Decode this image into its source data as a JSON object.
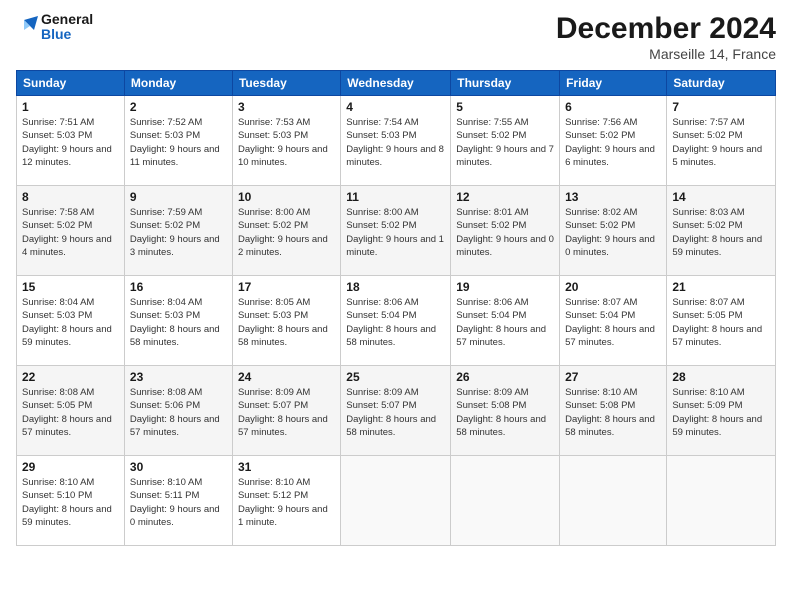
{
  "header": {
    "logo_line1": "General",
    "logo_line2": "Blue",
    "title": "December 2024",
    "location": "Marseille 14, France"
  },
  "weekdays": [
    "Sunday",
    "Monday",
    "Tuesday",
    "Wednesday",
    "Thursday",
    "Friday",
    "Saturday"
  ],
  "weeks": [
    [
      {
        "day": "1",
        "sunrise": "7:51 AM",
        "sunset": "5:03 PM",
        "daylight": "9 hours and 12 minutes."
      },
      {
        "day": "2",
        "sunrise": "7:52 AM",
        "sunset": "5:03 PM",
        "daylight": "9 hours and 11 minutes."
      },
      {
        "day": "3",
        "sunrise": "7:53 AM",
        "sunset": "5:03 PM",
        "daylight": "9 hours and 10 minutes."
      },
      {
        "day": "4",
        "sunrise": "7:54 AM",
        "sunset": "5:03 PM",
        "daylight": "9 hours and 8 minutes."
      },
      {
        "day": "5",
        "sunrise": "7:55 AM",
        "sunset": "5:02 PM",
        "daylight": "9 hours and 7 minutes."
      },
      {
        "day": "6",
        "sunrise": "7:56 AM",
        "sunset": "5:02 PM",
        "daylight": "9 hours and 6 minutes."
      },
      {
        "day": "7",
        "sunrise": "7:57 AM",
        "sunset": "5:02 PM",
        "daylight": "9 hours and 5 minutes."
      }
    ],
    [
      {
        "day": "8",
        "sunrise": "7:58 AM",
        "sunset": "5:02 PM",
        "daylight": "9 hours and 4 minutes."
      },
      {
        "day": "9",
        "sunrise": "7:59 AM",
        "sunset": "5:02 PM",
        "daylight": "9 hours and 3 minutes."
      },
      {
        "day": "10",
        "sunrise": "8:00 AM",
        "sunset": "5:02 PM",
        "daylight": "9 hours and 2 minutes."
      },
      {
        "day": "11",
        "sunrise": "8:00 AM",
        "sunset": "5:02 PM",
        "daylight": "9 hours and 1 minute."
      },
      {
        "day": "12",
        "sunrise": "8:01 AM",
        "sunset": "5:02 PM",
        "daylight": "9 hours and 0 minutes."
      },
      {
        "day": "13",
        "sunrise": "8:02 AM",
        "sunset": "5:02 PM",
        "daylight": "9 hours and 0 minutes."
      },
      {
        "day": "14",
        "sunrise": "8:03 AM",
        "sunset": "5:02 PM",
        "daylight": "8 hours and 59 minutes."
      }
    ],
    [
      {
        "day": "15",
        "sunrise": "8:04 AM",
        "sunset": "5:03 PM",
        "daylight": "8 hours and 59 minutes."
      },
      {
        "day": "16",
        "sunrise": "8:04 AM",
        "sunset": "5:03 PM",
        "daylight": "8 hours and 58 minutes."
      },
      {
        "day": "17",
        "sunrise": "8:05 AM",
        "sunset": "5:03 PM",
        "daylight": "8 hours and 58 minutes."
      },
      {
        "day": "18",
        "sunrise": "8:06 AM",
        "sunset": "5:04 PM",
        "daylight": "8 hours and 58 minutes."
      },
      {
        "day": "19",
        "sunrise": "8:06 AM",
        "sunset": "5:04 PM",
        "daylight": "8 hours and 57 minutes."
      },
      {
        "day": "20",
        "sunrise": "8:07 AM",
        "sunset": "5:04 PM",
        "daylight": "8 hours and 57 minutes."
      },
      {
        "day": "21",
        "sunrise": "8:07 AM",
        "sunset": "5:05 PM",
        "daylight": "8 hours and 57 minutes."
      }
    ],
    [
      {
        "day": "22",
        "sunrise": "8:08 AM",
        "sunset": "5:05 PM",
        "daylight": "8 hours and 57 minutes."
      },
      {
        "day": "23",
        "sunrise": "8:08 AM",
        "sunset": "5:06 PM",
        "daylight": "8 hours and 57 minutes."
      },
      {
        "day": "24",
        "sunrise": "8:09 AM",
        "sunset": "5:07 PM",
        "daylight": "8 hours and 57 minutes."
      },
      {
        "day": "25",
        "sunrise": "8:09 AM",
        "sunset": "5:07 PM",
        "daylight": "8 hours and 58 minutes."
      },
      {
        "day": "26",
        "sunrise": "8:09 AM",
        "sunset": "5:08 PM",
        "daylight": "8 hours and 58 minutes."
      },
      {
        "day": "27",
        "sunrise": "8:10 AM",
        "sunset": "5:08 PM",
        "daylight": "8 hours and 58 minutes."
      },
      {
        "day": "28",
        "sunrise": "8:10 AM",
        "sunset": "5:09 PM",
        "daylight": "8 hours and 59 minutes."
      }
    ],
    [
      {
        "day": "29",
        "sunrise": "8:10 AM",
        "sunset": "5:10 PM",
        "daylight": "8 hours and 59 minutes."
      },
      {
        "day": "30",
        "sunrise": "8:10 AM",
        "sunset": "5:11 PM",
        "daylight": "9 hours and 0 minutes."
      },
      {
        "day": "31",
        "sunrise": "8:10 AM",
        "sunset": "5:12 PM",
        "daylight": "9 hours and 1 minute."
      },
      null,
      null,
      null,
      null
    ]
  ],
  "labels": {
    "sunrise": "Sunrise:",
    "sunset": "Sunset:",
    "daylight": "Daylight:"
  }
}
